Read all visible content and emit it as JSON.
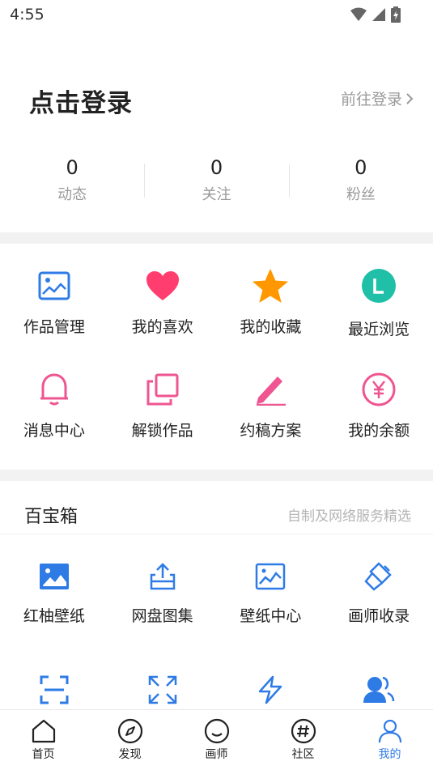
{
  "status_bar": {
    "time": "4:55"
  },
  "login": {
    "title": "点击登录",
    "link_label": "前往登录"
  },
  "stats": [
    {
      "value": "0",
      "label": "动态"
    },
    {
      "value": "0",
      "label": "关注"
    },
    {
      "value": "0",
      "label": "粉丝"
    }
  ],
  "menu": [
    {
      "label": "作品管理",
      "icon": "image-frame-icon",
      "color": "#2e7be6"
    },
    {
      "label": "我的喜欢",
      "icon": "heart-icon",
      "color": "#ff3d6e"
    },
    {
      "label": "我的收藏",
      "icon": "star-icon",
      "color": "#ff9800"
    },
    {
      "label": "最近浏览",
      "icon": "recent-l-icon",
      "color": "#1fbfa8"
    },
    {
      "label": "消息中心",
      "icon": "bell-icon",
      "color": "#ef5590"
    },
    {
      "label": "解锁作品",
      "icon": "copy-icon",
      "color": "#ef5590"
    },
    {
      "label": "约稿方案",
      "icon": "pen-icon",
      "color": "#ef5590"
    },
    {
      "label": "我的余额",
      "icon": "yen-icon",
      "color": "#ef5590"
    }
  ],
  "toolbox": {
    "title": "百宝箱",
    "subtitle": "自制及网络服务精选",
    "items": [
      {
        "label": "红柚壁纸",
        "icon": "wallpaper-icon"
      },
      {
        "label": "网盘图集",
        "icon": "cloud-upload-icon"
      },
      {
        "label": "壁纸中心",
        "icon": "wallpaper-center-icon"
      },
      {
        "label": "画师收录",
        "icon": "brush-icon"
      },
      {
        "label": "",
        "icon": "scan-icon"
      },
      {
        "label": "",
        "icon": "expand-icon"
      },
      {
        "label": "",
        "icon": "lightning-icon"
      },
      {
        "label": "",
        "icon": "users-icon"
      }
    ]
  },
  "bottom_nav": [
    {
      "label": "首页",
      "icon": "home-icon",
      "active": false
    },
    {
      "label": "发现",
      "icon": "compass-icon",
      "active": false
    },
    {
      "label": "画师",
      "icon": "smile-icon",
      "active": false
    },
    {
      "label": "社区",
      "icon": "hashtag-icon",
      "active": false
    },
    {
      "label": "我的",
      "icon": "user-icon",
      "active": true
    }
  ],
  "colors": {
    "accent": "#2e7be6",
    "pink": "#ef5590",
    "divider": "#f2f2f2"
  }
}
